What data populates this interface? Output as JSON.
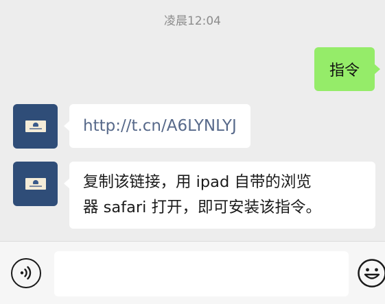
{
  "timestamp": "凌晨12:04",
  "messages": {
    "sent": {
      "text": "指令"
    },
    "link": {
      "text": "http://t.cn/A6LYNLYJ"
    },
    "instruction": {
      "text": "复制该链接，用 ipad 自带的浏览\n器 safari 打开，即可安装该指令。"
    }
  },
  "input": {
    "value": "",
    "placeholder": ""
  },
  "icons": {
    "voice": "voice-icon",
    "emoji": "emoji-icon"
  },
  "colors": {
    "background": "#ededed",
    "sent_bubble": "#95ec69",
    "received_bubble": "#ffffff",
    "avatar": "#2f4d78",
    "link_text": "#57698a"
  }
}
